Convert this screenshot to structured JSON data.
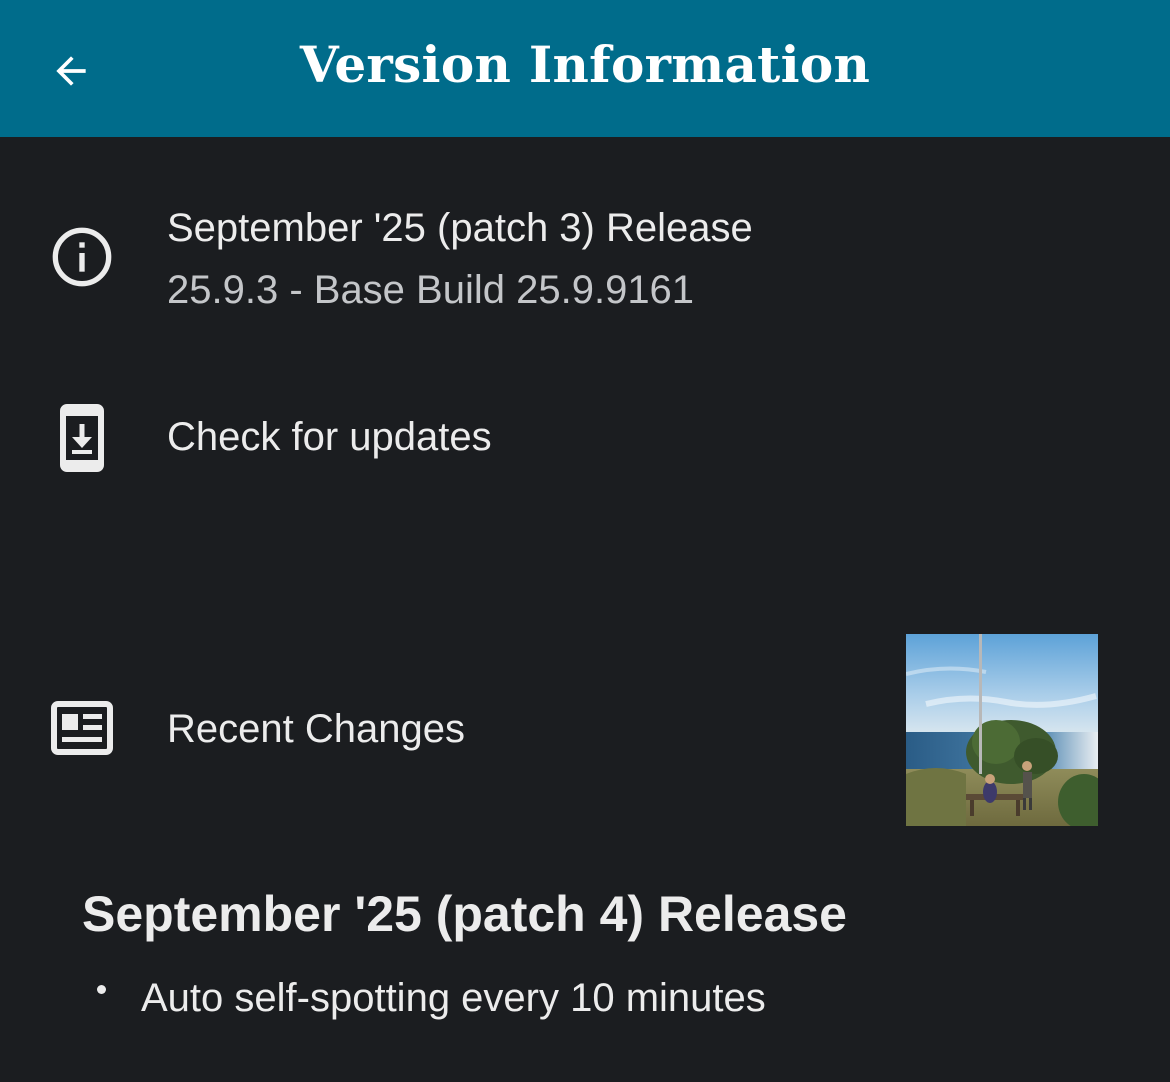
{
  "header": {
    "title": "Version Information",
    "back_icon": "arrow-back-icon",
    "background_color": "#006c8b"
  },
  "version_row": {
    "icon": "info-icon",
    "title": "September '25 (patch 3) Release",
    "subtitle": "25.9.3 - Base Build 25.9.9161"
  },
  "update_row": {
    "icon": "phone-download-icon",
    "label": "Check for updates"
  },
  "changes_row": {
    "icon": "article-icon",
    "label": "Recent Changes",
    "thumbnail": "coastal-photo-thumbnail"
  },
  "release_notes": {
    "title": "September '25 (patch 4) Release",
    "items": [
      "Auto self-spotting every 10 minutes"
    ]
  },
  "colors": {
    "background": "#1b1d20",
    "primary_text": "#ececec",
    "secondary_text": "#c4c6c9"
  }
}
